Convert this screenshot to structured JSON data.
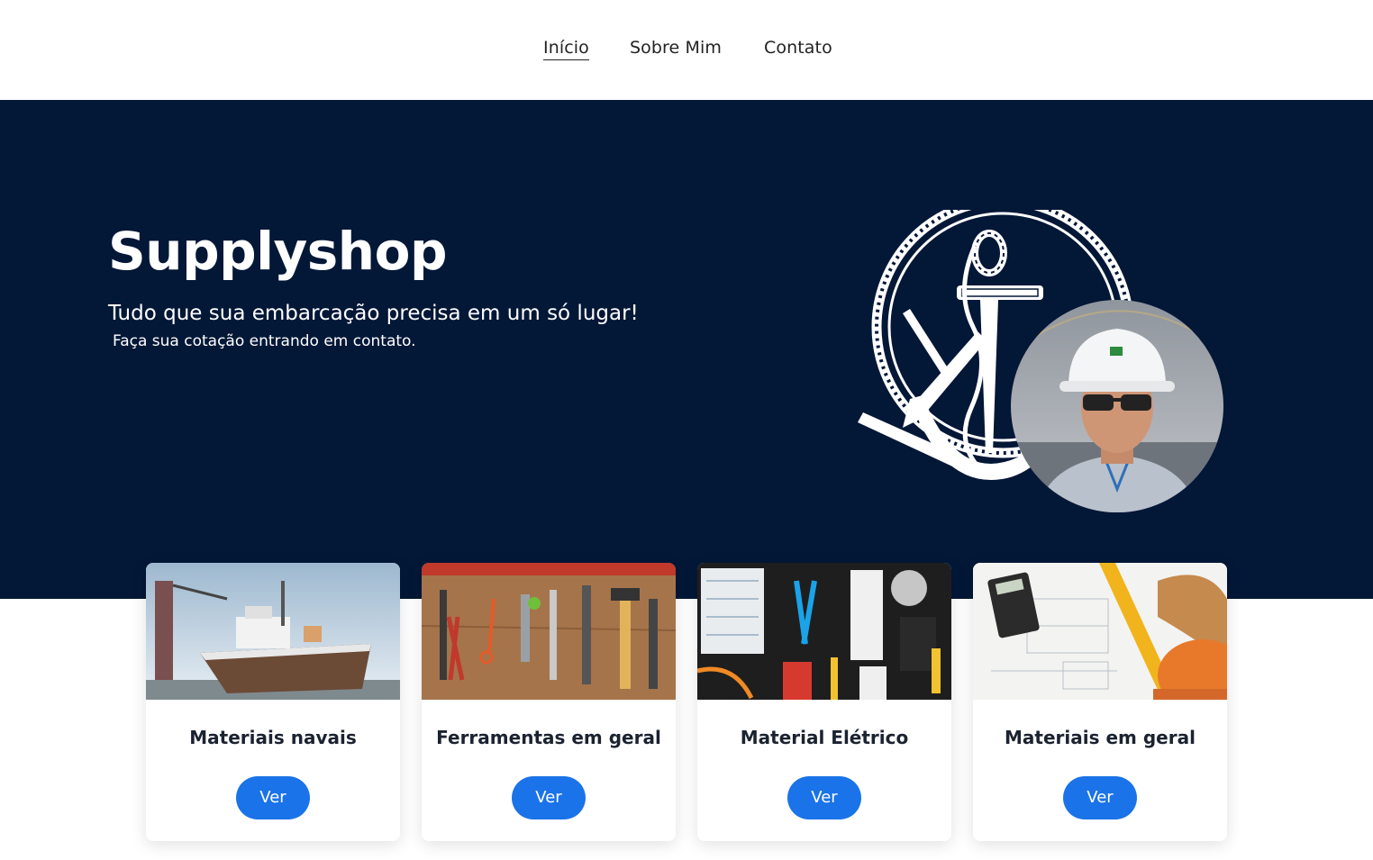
{
  "nav": {
    "items": [
      {
        "label": "Início",
        "active": true
      },
      {
        "label": "Sobre Mim",
        "active": false
      },
      {
        "label": "Contato",
        "active": false
      }
    ]
  },
  "hero": {
    "title": "Supplyshop",
    "subtitle": "Tudo que sua embarcação precisa em um só lugar!",
    "description": "Faça sua cotação entrando em contato.",
    "background_color": "#031737",
    "art": [
      "anchor-logo",
      "profile-photo"
    ]
  },
  "cards": [
    {
      "title": "Materiais navais",
      "button": "Ver",
      "image": "ship-photo"
    },
    {
      "title": "Ferramentas em geral",
      "button": "Ver",
      "image": "tools-photo"
    },
    {
      "title": "Material Elétrico",
      "button": "Ver",
      "image": "electrical-photo"
    },
    {
      "title": "Materiais em geral",
      "button": "Ver",
      "image": "construction-photo"
    }
  ],
  "colors": {
    "accent": "#1a73e8",
    "hero_bg": "#031737",
    "text": "#222222"
  }
}
